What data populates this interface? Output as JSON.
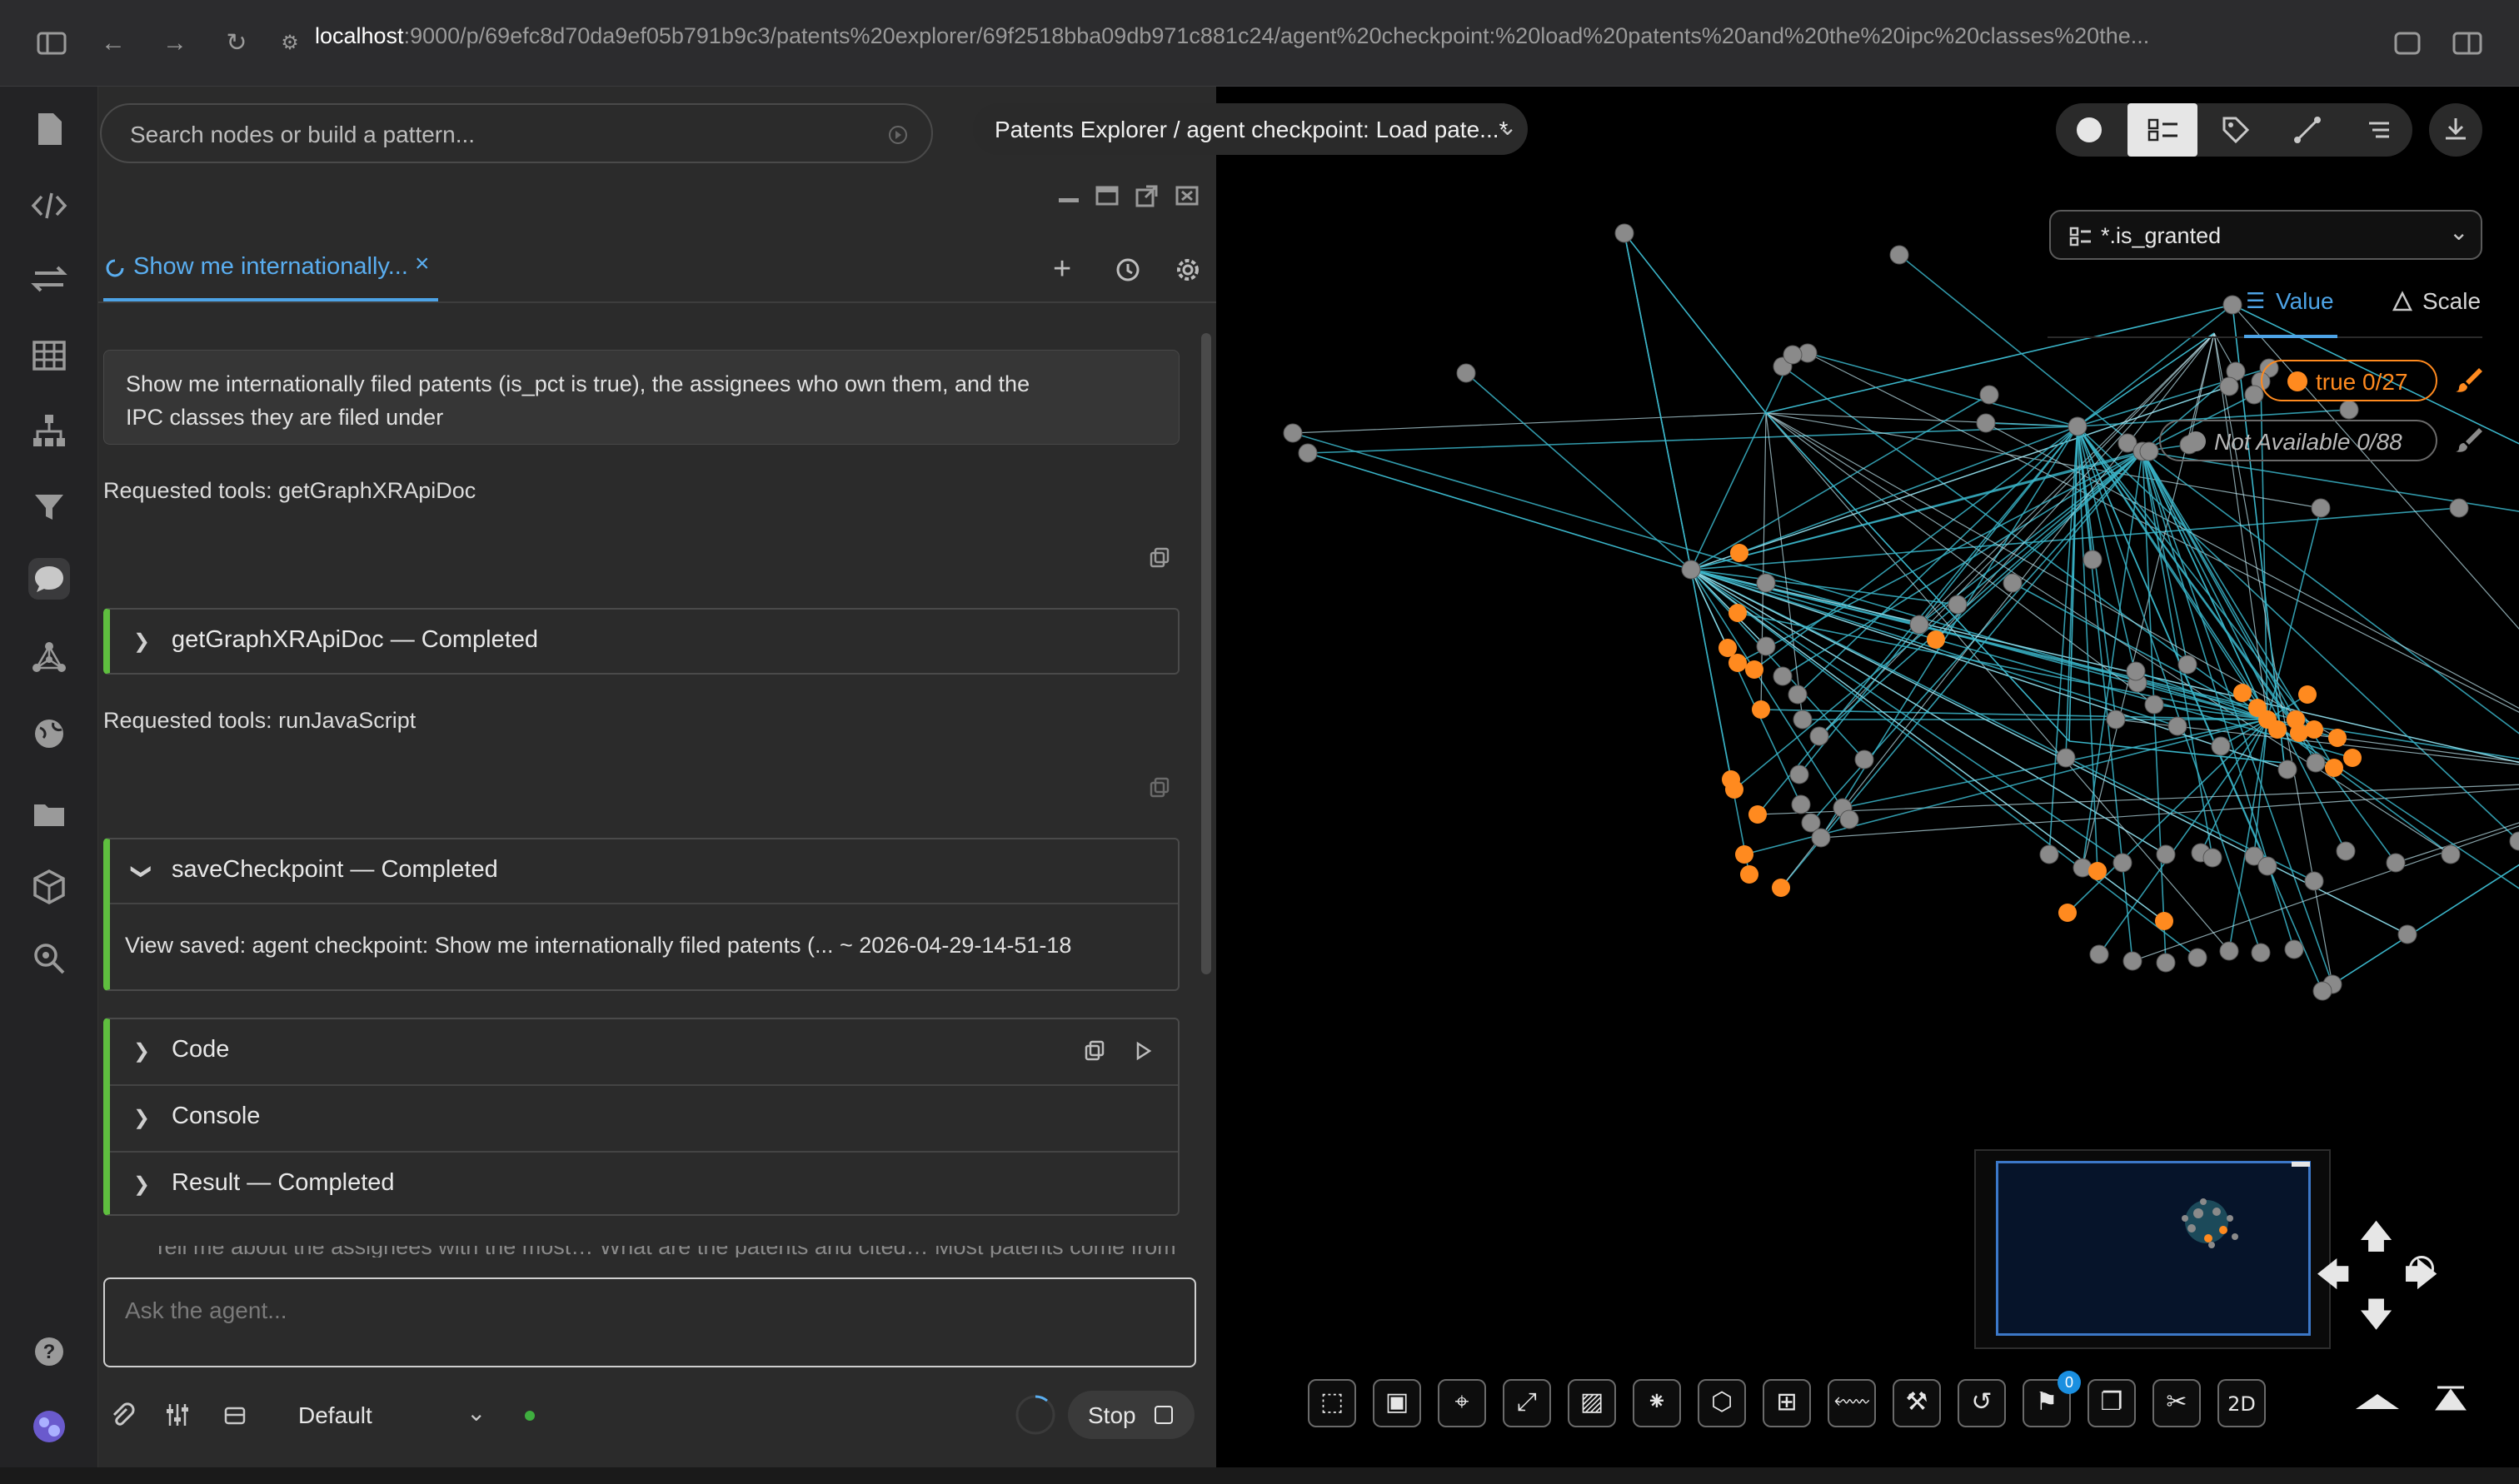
{
  "browser": {
    "url_host": "localhost",
    "url_rest": ":9000/p/69efc8d70da9ef05b791b9c3/patents%20explorer/69f2518bba09db971c881c24/agent%20checkpoint:%20load%20patents%20and%20the%20ipc%20classes%20the..."
  },
  "search": {
    "placeholder": "Search nodes or build a pattern..."
  },
  "breadcrumb": "Patents Explorer / agent checkpoint: Load pate...*",
  "chat": {
    "tab_label": "Show me internationally...",
    "user_message": [
      "Show me internationally filed patents (is_pct is true), the assignees who own them, and the",
      "IPC classes they are filed under"
    ],
    "requested_1": "Requested tools: getGraphXRApiDoc",
    "tool_1": "getGraphXRApiDoc — Completed",
    "requested_2": "Requested tools: runJavaScript",
    "tool_2": "saveCheckpoint — Completed",
    "tool_2_body": "View saved: agent checkpoint: Show me internationally filed patents (... ~ 2026-04-29-14-51-18",
    "code_label": "Code",
    "console_label": "Console",
    "result_label": "Result — Completed",
    "overflow_text": "Tell me about the assignees with the most… What are the patents and cited… Most patents come from",
    "ask_placeholder": "Ask the agent...",
    "model": "Default",
    "stop_label": "Stop"
  },
  "legend": {
    "property": "*.is_granted",
    "tab_value": "Value",
    "tab_scale": "Scale",
    "chip_true": "true 0/27",
    "chip_na": "Not Available 0/88",
    "true_color": "#ff8a1f",
    "na_color": "#8a8a8a"
  },
  "toolbar": {
    "pin_badge": "0",
    "mode_2d": "2D"
  },
  "colors": {
    "edge": "#3ab4c8",
    "accent": "#4da3e6",
    "success": "#5fbf3f"
  }
}
